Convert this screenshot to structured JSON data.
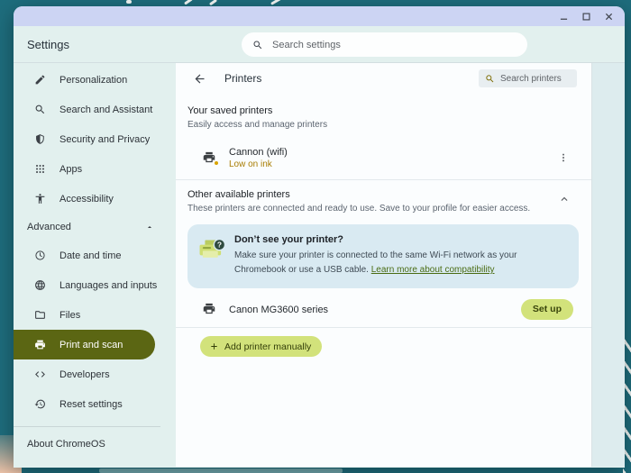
{
  "header": {
    "title": "Settings",
    "search_placeholder": "Search settings"
  },
  "sidebar": {
    "items": [
      {
        "label": "Personalization",
        "icon": "pencil-icon"
      },
      {
        "label": "Search and Assistant",
        "icon": "search-icon"
      },
      {
        "label": "Security and Privacy",
        "icon": "shield-icon"
      },
      {
        "label": "Apps",
        "icon": "apps-grid-icon"
      },
      {
        "label": "Accessibility",
        "icon": "accessibility-icon"
      }
    ],
    "advanced": {
      "label": "Advanced"
    },
    "advanced_items": [
      {
        "label": "Date and time",
        "icon": "clock-icon"
      },
      {
        "label": "Languages and inputs",
        "icon": "globe-icon"
      },
      {
        "label": "Files",
        "icon": "folder-icon"
      },
      {
        "label": "Print and scan",
        "icon": "printer-icon",
        "selected": true
      },
      {
        "label": "Developers",
        "icon": "code-icon"
      },
      {
        "label": "Reset settings",
        "icon": "restore-icon"
      }
    ],
    "about": {
      "label": "About ChromeOS"
    }
  },
  "printers_page": {
    "title": "Printers",
    "search_placeholder": "Search printers",
    "saved": {
      "heading": "Your saved printers",
      "subheading": "Easily access and manage printers",
      "printer": {
        "name": "Cannon (wifi)",
        "status": "Low on ink"
      }
    },
    "available": {
      "heading": "Other available printers",
      "subheading": "These printers are connected and ready to use. Save to your profile for easier access.",
      "help": {
        "heading": "Don’t see your printer?",
        "body": "Make sure your printer is connected to the same Wi-Fi network as your Chromebook or use a USB cable.",
        "link_text": "Learn more about compatibility"
      },
      "printer": {
        "name": "Canon MG3600 series",
        "action_label": "Set up"
      }
    },
    "add_printer_label": "Add printer manually"
  },
  "colors": {
    "desktop": "#1e6d7d",
    "titlebar": "#ccd4f3",
    "selected_pill": "#5b6613",
    "lime_button": "#d2e27b",
    "status_amber": "#a87c00",
    "link_green": "#4a6c13",
    "help_box": "#d9eaf2"
  }
}
